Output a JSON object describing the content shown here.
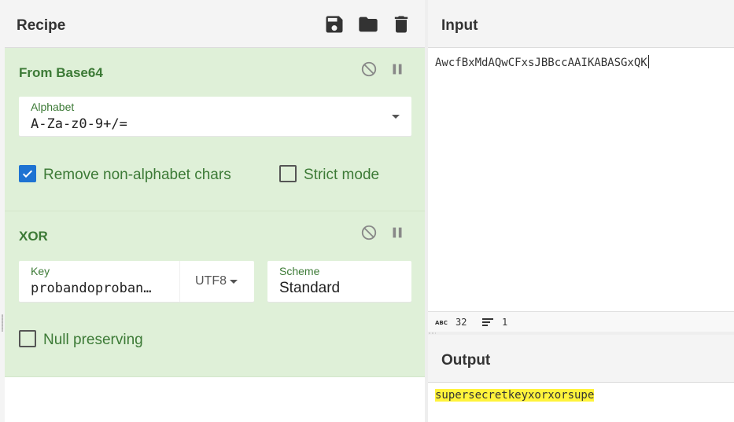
{
  "recipe": {
    "title": "Recipe",
    "actions": [
      "save-icon",
      "folder-icon",
      "trash-icon"
    ]
  },
  "operations": [
    {
      "name": "From Base64",
      "alphabet": {
        "label": "Alphabet",
        "value": "A-Za-z0-9+/="
      },
      "remove_non_alphabet": {
        "label": "Remove non-alphabet chars",
        "checked": true
      },
      "strict_mode": {
        "label": "Strict mode",
        "checked": false
      }
    },
    {
      "name": "XOR",
      "key": {
        "label": "Key",
        "value": "probandoproban…",
        "encoding": "UTF8"
      },
      "scheme": {
        "label": "Scheme",
        "value": "Standard"
      },
      "null_preserving": {
        "label": "Null preserving",
        "checked": false
      }
    }
  ],
  "input": {
    "title": "Input",
    "text": "AwcfBxMdAQwCFxsJBBccAAIKABASGxQK",
    "stats": {
      "chars": "32",
      "lines": "1"
    }
  },
  "output": {
    "title": "Output",
    "text": "supersecretkeyxorxorsupe"
  },
  "colors": {
    "op_background": "#dff0d8",
    "op_accent": "#3c7a36",
    "checkbox_checked": "#1e73d2",
    "output_highlight": "#fff33b"
  }
}
